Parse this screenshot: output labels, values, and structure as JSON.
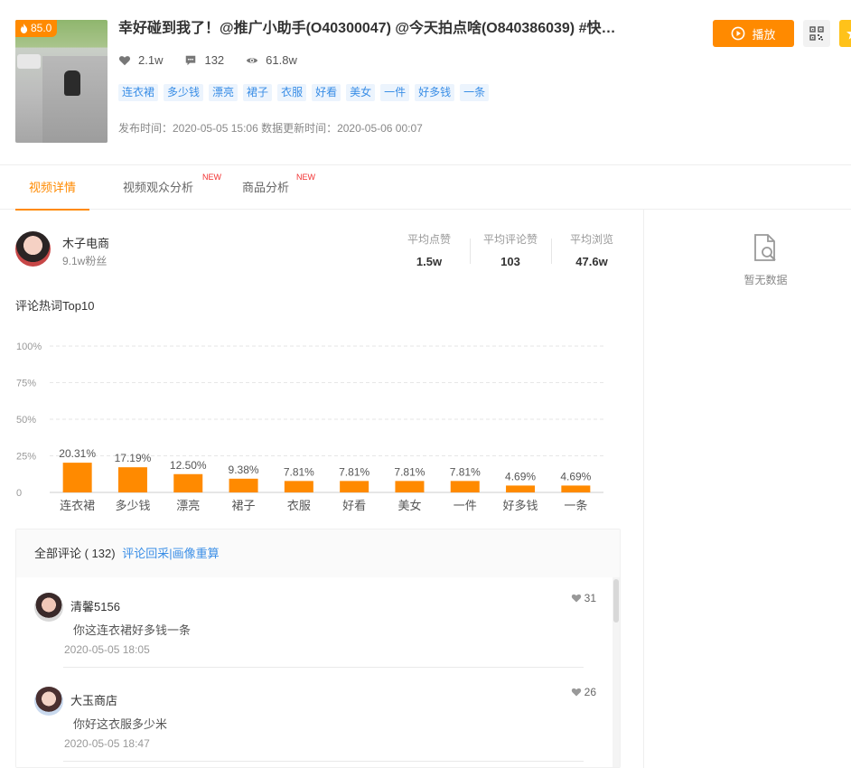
{
  "video": {
    "score": "85.0",
    "title": "幸好碰到我了！@推广小助手(O40300047) @今天拍点啥(O840386039) #快…",
    "likes": "2.1w",
    "comments": "132",
    "views": "61.8w",
    "tags": [
      "连衣裙",
      "多少钱",
      "漂亮",
      "裙子",
      "衣服",
      "好看",
      "美女",
      "一件",
      "好多钱",
      "一条"
    ],
    "publish_info": "发布时间：2020-05-05 15:06 数据更新时间：2020-05-06 00:07"
  },
  "actions": {
    "play_label": "播放",
    "accent_color": "#ff8a00"
  },
  "tabs": [
    {
      "label": "视频详情",
      "active": true
    },
    {
      "label": "视频观众分析",
      "badge": "NEW"
    },
    {
      "label": "商品分析",
      "badge": "NEW"
    }
  ],
  "author": {
    "name": "木子电商",
    "fans": "9.1w粉丝"
  },
  "averages": [
    {
      "label": "平均点赞",
      "value": "1.5w"
    },
    {
      "label": "平均评论赞",
      "value": "103"
    },
    {
      "label": "平均浏览",
      "value": "47.6w"
    }
  ],
  "side_panel": {
    "empty_label": "暂无数据"
  },
  "chart_section": {
    "title": "评论热词Top10"
  },
  "chart_data": {
    "type": "bar",
    "categories": [
      "连衣裙",
      "多少钱",
      "漂亮",
      "裙子",
      "衣服",
      "好看",
      "美女",
      "一件",
      "好多钱",
      "一条"
    ],
    "values": [
      20.31,
      17.19,
      12.5,
      9.38,
      7.81,
      7.81,
      7.81,
      7.81,
      4.69,
      4.69
    ],
    "value_labels": [
      "20.31%",
      "17.19%",
      "12.50%",
      "9.38%",
      "7.81%",
      "7.81%",
      "7.81%",
      "7.81%",
      "4.69%",
      "4.69%"
    ],
    "y_ticks": [
      "0",
      "25%",
      "50%",
      "75%",
      "100%"
    ],
    "ylim": [
      0,
      100
    ],
    "grid": true,
    "bar_color": "#ff8a00"
  },
  "comments_panel": {
    "header": "全部评论 ( 132)",
    "link": "评论回采|画像重算",
    "items": [
      {
        "name": "清馨5156",
        "text": "你这连衣裙好多钱一条",
        "time": "2020-05-05 18:05",
        "likes": "31"
      },
      {
        "name": "大玉商店",
        "text": "你好这衣服多少米",
        "time": "2020-05-05 18:47",
        "likes": "26"
      }
    ]
  }
}
